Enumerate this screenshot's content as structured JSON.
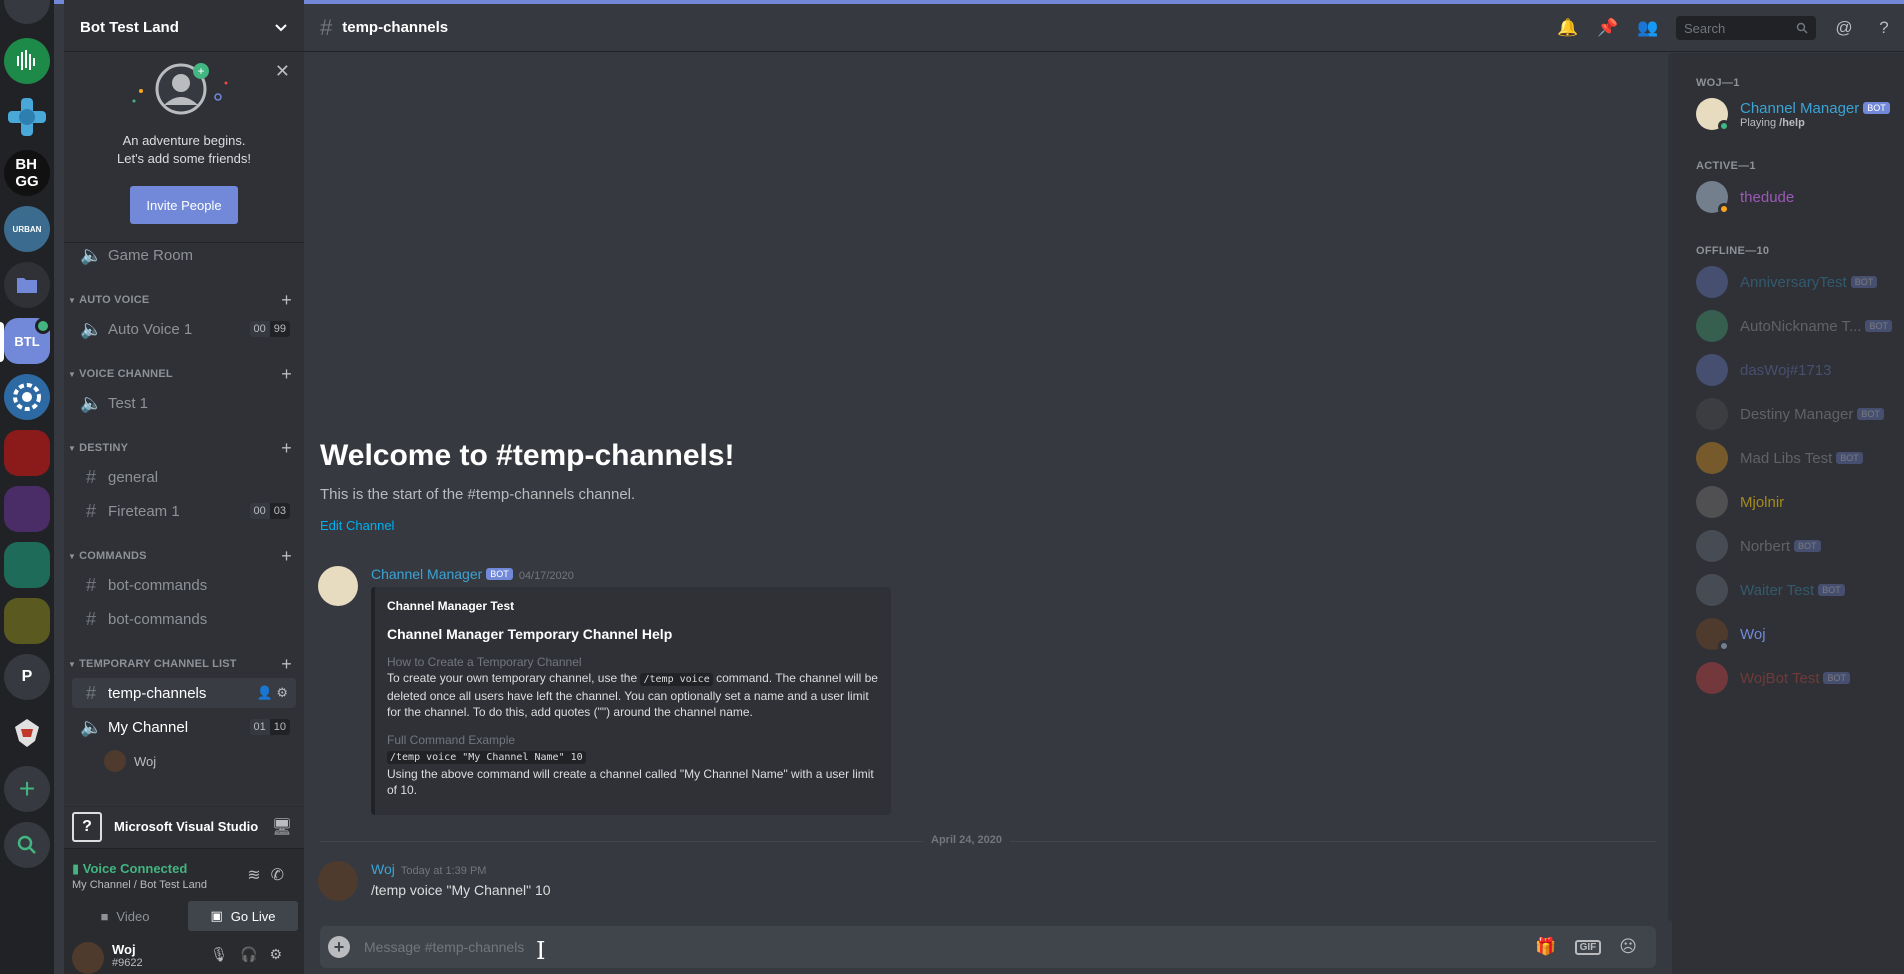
{
  "guild": {
    "name": "Bot Test Land"
  },
  "servers": [
    {
      "label": "",
      "color": "#24a35a",
      "icon": "server-icon-equalizer"
    },
    {
      "label": "",
      "color": "#202225",
      "icon": "server-icon-cross"
    },
    {
      "label": "BH GG",
      "color": "#111111",
      "icon": "server-icon-bhgg"
    },
    {
      "label": "",
      "color": "#3b6c8f",
      "icon": "server-icon-urban"
    },
    {
      "label": "",
      "color": "#202225",
      "icon": "folder-icon"
    },
    {
      "label": "BTL",
      "color": "#7289da",
      "icon": "server-icon-btl"
    },
    {
      "label": "",
      "color": "#3a6ea5",
      "icon": "server-icon-gear"
    },
    {
      "label": "",
      "color": "#b22222",
      "icon": "server-folder-red"
    },
    {
      "label": "",
      "color": "#5d3a7a",
      "icon": "server-folder-purple"
    },
    {
      "label": "",
      "color": "#2e7d6b",
      "icon": "server-folder-teal"
    },
    {
      "label": "",
      "color": "#6b6b26",
      "icon": "server-folder-olive"
    },
    {
      "label": "P",
      "color": "#36393f",
      "icon": "server-icon-p"
    },
    {
      "label": "",
      "color": "#202225",
      "icon": "server-icon-eagle"
    }
  ],
  "invite": {
    "line1": "An adventure begins.",
    "line2": "Let's add some friends!",
    "button": "Invite People"
  },
  "channels": {
    "game_room": "Game Room",
    "cat_auto_voice": "AUTO VOICE",
    "auto_voice_1": "Auto Voice 1",
    "auto_voice_1_counter": [
      "00",
      "99"
    ],
    "cat_voice_channel": "VOICE CHANNEL",
    "test_1": "Test 1",
    "cat_destiny": "DESTINY",
    "general": "general",
    "fireteam_1": "Fireteam 1",
    "fireteam_1_counter": [
      "00",
      "03"
    ],
    "cat_commands": "COMMANDS",
    "bot_commands_1": "bot-commands",
    "bot_commands_2": "bot-commands",
    "cat_temp_list": "TEMPORARY CHANNEL LIST",
    "temp_channels": "temp-channels",
    "my_channel": "My Channel",
    "my_channel_counter": [
      "01",
      "10"
    ],
    "voice_user": "Woj"
  },
  "activity": {
    "name": "Microsoft Visual Studio"
  },
  "voice_panel": {
    "status": "Voice Connected",
    "location": "My Channel / Bot Test Land",
    "video": "Video",
    "go_live": "Go Live"
  },
  "user_panel": {
    "name": "Woj",
    "tag": "#9622"
  },
  "header": {
    "channel": "temp-channels",
    "search_placeholder": "Search"
  },
  "welcome": {
    "title": "Welcome to #temp-channels!",
    "subtitle": "This is the start of the #temp-channels channel.",
    "edit": "Edit Channel"
  },
  "messages": [
    {
      "author": "Channel Manager",
      "bot_tag": "BOT",
      "time": "04/17/2020",
      "author_color": "#3ba4d6",
      "embed": {
        "author": "Channel Manager Test",
        "title": "Channel Manager Temporary Channel Help",
        "field1_name": "How to Create a Temporary Channel",
        "field1_a": "To create your own temporary channel, use the",
        "field1_code": "/temp voice",
        "field1_b": "command. The channel will be deleted once all users have left the channel. You can optionally set a name and a user limit for the channel. To do this, add quotes (\"\") around the channel name.",
        "field2_name": "Full Command Example",
        "field2_code": "/temp voice \"My Channel Name\" 10",
        "field2_text": "Using the above command will create a channel called \"My Channel Name\" with a user limit of 10."
      }
    },
    {
      "author": "Woj",
      "time": "Today at 1:39 PM",
      "text": "/temp voice \"My Channel\" 10",
      "author_color": "#3ba4d6"
    }
  ],
  "date_divider": "April 24, 2020",
  "composer": {
    "placeholder": "Message #temp-channels",
    "gif": "GIF"
  },
  "members": {
    "sec_woj": "WOJ—1",
    "sec_active": "ACTIVE—1",
    "sec_offline": "OFFLINE—10",
    "list": [
      {
        "name": "Channel Manager",
        "bot": "BOT",
        "activity_prefix": "Playing",
        "activity": "/help",
        "color": "#3ba4d6",
        "av": "#e8dcc0"
      },
      {
        "name": "thedude",
        "color": "#9b59b6",
        "av": "#747f8d"
      },
      {
        "name": "AnniversaryTest",
        "bot": "BOT",
        "color": "#3ba4d6",
        "av": "#7289da"
      },
      {
        "name": "AutoNickname T...",
        "bot": "BOT",
        "color": "#b9bbbe",
        "av": "#43b581"
      },
      {
        "name": "dasWoj#1713",
        "color": "#7289da",
        "av": "#7289da"
      },
      {
        "name": "Destiny Manager",
        "bot": "BOT",
        "color": "#b9bbbe",
        "av": "#555555"
      },
      {
        "name": "Mad Libs Test",
        "bot": "BOT",
        "color": "#b9bbbe",
        "av": "#faa61a"
      },
      {
        "name": "Mjolnir",
        "color": "#f1c40f",
        "av": "#666666"
      },
      {
        "name": "Norbert",
        "bot": "BOT",
        "color": "#b9bbbe",
        "av": "#747f8d"
      },
      {
        "name": "Waiter Test",
        "bot": "BOT",
        "color": "#3ba4d6",
        "av": "#747f8d"
      },
      {
        "name": "Woj",
        "color": "#7289da",
        "av": "#4e3b2d"
      },
      {
        "name": "WojBot Test",
        "bot": "BOT",
        "color": "#e74c3c",
        "av": "#f04747"
      }
    ]
  }
}
